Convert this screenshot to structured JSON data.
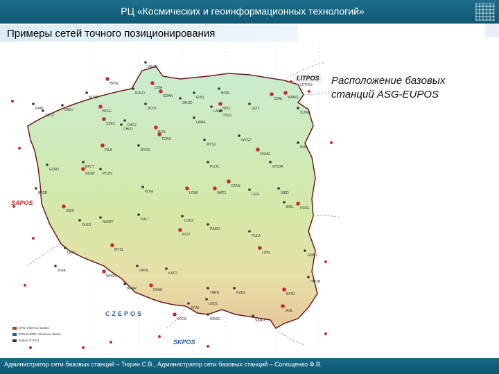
{
  "header": {
    "title": "РЦ «Космических и геоинформационных технологий»"
  },
  "slide": {
    "subtitle": "Примеры сетей точного позиционирования",
    "caption_line1": "Расположение базовых",
    "caption_line2": "станций ASG-EUPOS"
  },
  "footer": {
    "text": "Администратор сети базовых станций – Тюрин С.В.,  Администратор сети базовых станций – Солощенко Ф.В."
  },
  "map": {
    "network_tags": {
      "litpos": "LITPOS",
      "sapos": "SAPOS",
      "skpos": "SKPOS",
      "czepos": "CZEPOS"
    },
    "legend": [
      "EPN reference station",
      "EPN-EUREF reference station",
      "station of EPN"
    ],
    "colors": {
      "land_low": "#bfe3b0",
      "land_mid": "#d6e7a8",
      "land_high": "#e8d8a6",
      "border": "#5e1616",
      "station": "#c62b2b",
      "station_small": "#333333",
      "sea": "#ffffff"
    },
    "stations": [
      {
        "name": "BPZE"
      },
      {
        "name": "WLAD"
      },
      {
        "name": "KOLO"
      },
      {
        "name": "GDAN"
      },
      {
        "name": "ELBL"
      },
      {
        "name": "NOSE"
      },
      {
        "name": "DZIA"
      },
      {
        "name": "BPRL"
      },
      {
        "name": "LITPOS"
      },
      {
        "name": "MAMO"
      },
      {
        "name": "GWLI"
      },
      {
        "name": "SZCZ"
      },
      {
        "name": "BOLE"
      },
      {
        "name": "CHOJ"
      },
      {
        "name": "BCHI"
      },
      {
        "name": "BPCI"
      },
      {
        "name": "GRUD"
      },
      {
        "name": "OSLE"
      },
      {
        "name": "CBAL"
      },
      {
        "name": "GIZY"
      },
      {
        "name": "SUWA"
      },
      {
        "name": "SZEC"
      },
      {
        "name": "CHOJ"
      },
      {
        "name": "LAMA"
      },
      {
        "name": "BLIA"
      },
      {
        "name": "KANI"
      },
      {
        "name": "BYDG"
      },
      {
        "name": "TORU"
      },
      {
        "name": "WYSZ"
      },
      {
        "name": "BIAL"
      },
      {
        "name": "PILA"
      },
      {
        "name": "MYSZ"
      },
      {
        "name": "LAMA"
      },
      {
        "name": "OSMG"
      },
      {
        "name": "GORZ"
      },
      {
        "name": "BPZT"
      },
      {
        "name": "INOW"
      },
      {
        "name": "PLOC"
      },
      {
        "name": "WODA"
      },
      {
        "name": "CZAN"
      },
      {
        "name": "POZN"
      },
      {
        "name": "KONI"
      },
      {
        "name": "LOWI"
      },
      {
        "name": "LEGI"
      },
      {
        "name": "BPZB"
      },
      {
        "name": "ZIGR"
      },
      {
        "name": "KALI"
      },
      {
        "name": "LODZ"
      },
      {
        "name": "WAT1"
      },
      {
        "name": "SIED"
      },
      {
        "name": "BIEL"
      },
      {
        "name": "PRZE"
      },
      {
        "name": "OLES"
      },
      {
        "name": "NWMT"
      },
      {
        "name": "PIOT"
      },
      {
        "name": "RADO"
      },
      {
        "name": "PULA"
      },
      {
        "name": "LUBL"
      },
      {
        "name": "ZAMO"
      },
      {
        "name": "HRUB"
      },
      {
        "name": "BPRZ"
      },
      {
        "name": "LESZ"
      },
      {
        "name": "ZIGR"
      },
      {
        "name": "WROC"
      },
      {
        "name": "OPOL"
      },
      {
        "name": "KATO"
      },
      {
        "name": "KRAK"
      },
      {
        "name": "TARN"
      },
      {
        "name": "RZES"
      },
      {
        "name": "JASL"
      },
      {
        "name": "NWSC"
      },
      {
        "name": "ZYWI"
      },
      {
        "name": "KROS"
      },
      {
        "name": "SANO"
      },
      {
        "name": "USDL"
      },
      {
        "name": "MYSL"
      },
      {
        "name": "BPRR"
      }
    ]
  }
}
